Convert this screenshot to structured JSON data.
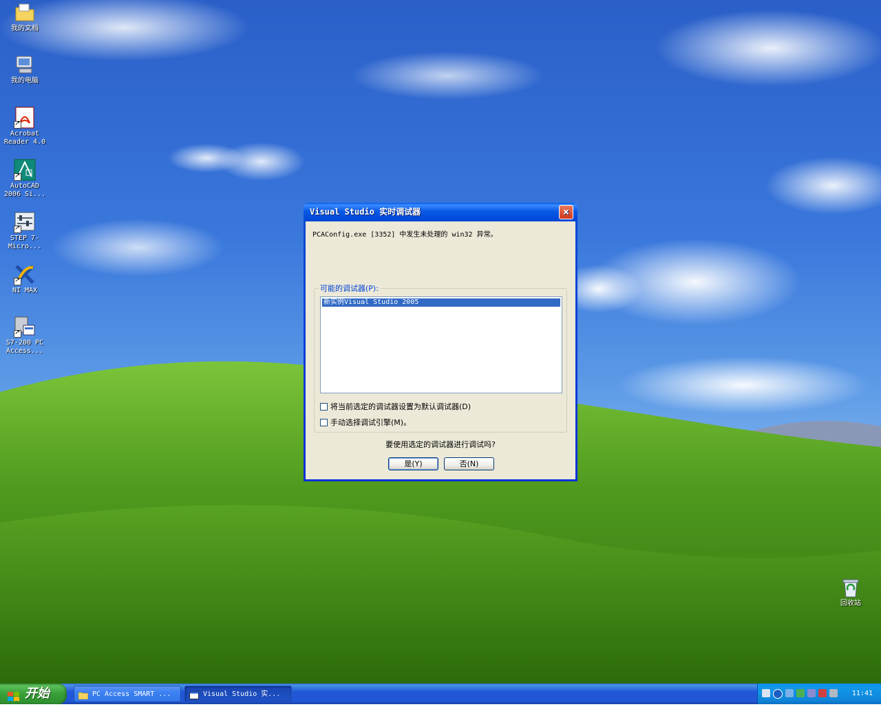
{
  "desktop": {
    "icons": [
      {
        "label": "我的文档"
      },
      {
        "label": "我的电脑"
      },
      {
        "label": "Acrobat Reader 4.0"
      },
      {
        "label": "AutoCAD 2006 Si..."
      },
      {
        "label": "STEP 7-Micro..."
      },
      {
        "label": "NI MAX"
      },
      {
        "label": "S7-200 PC Access..."
      },
      {
        "label": "回收站"
      }
    ]
  },
  "dialog": {
    "title": "Visual Studio 实时调试器",
    "close_label": "×",
    "message": "PCAConfig.exe [3352] 中发生未处理的 win32 异常。",
    "group_label": "可能的调试器(P):",
    "list_items": [
      "新实例Visual Studio 2005"
    ],
    "checkbox_default": "将当前选定的调试器设置为默认调试器(D)",
    "checkbox_manual": "手动选择调试引擎(M)。",
    "question": "要使用选定的调试器进行调试吗?",
    "yes_label": "是(Y)",
    "no_label": "否(N)"
  },
  "taskbar": {
    "start_label": "开始",
    "tasks": [
      {
        "label": "PC Access SMART ..."
      },
      {
        "label": "Visual Studio 实..."
      }
    ],
    "clock": "11:41"
  },
  "colors": {
    "titlebar": "#0a5ae6",
    "dialog_bg": "#ece9d8",
    "selection": "#316ac5",
    "start_green": "#37a037",
    "taskbar_blue": "#2157d7"
  }
}
